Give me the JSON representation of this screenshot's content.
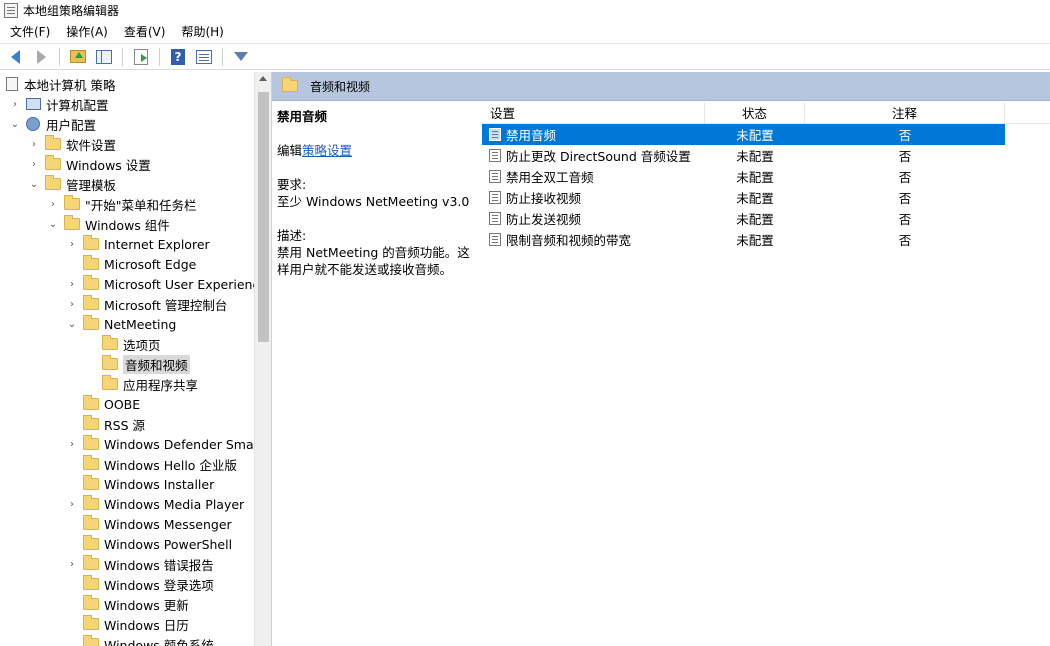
{
  "window": {
    "title": "本地组策略编辑器"
  },
  "menu": [
    "文件(F)",
    "操作(A)",
    "查看(V)",
    "帮助(H)"
  ],
  "toolbar": {
    "icons": [
      "back-icon",
      "forward-icon",
      "up-folder-icon",
      "show-hide-tree-icon",
      "export-list-icon",
      "help-icon",
      "properties-icon",
      "filter-icon"
    ]
  },
  "tree": {
    "root": "本地计算机 策略",
    "items": [
      {
        "label": "计算机配置",
        "chevron": "›",
        "icon": "pc"
      },
      {
        "label": "用户配置",
        "chevron": "⌄",
        "icon": "user"
      },
      {
        "label": "软件设置",
        "chevron": "›",
        "icon": "folder"
      },
      {
        "label": "Windows 设置",
        "chevron": "›",
        "icon": "folder"
      },
      {
        "label": "管理模板",
        "chevron": "⌄",
        "icon": "folder"
      },
      {
        "label": "\"开始\"菜单和任务栏",
        "chevron": "›",
        "icon": "folder"
      },
      {
        "label": "Windows 组件",
        "chevron": "⌄",
        "icon": "folder"
      },
      {
        "label": "Internet Explorer",
        "chevron": "›",
        "icon": "folder"
      },
      {
        "label": "Microsoft Edge",
        "chevron": "",
        "icon": "folder"
      },
      {
        "label": "Microsoft User Experience",
        "chevron": "›",
        "icon": "folder"
      },
      {
        "label": "Microsoft 管理控制台",
        "chevron": "›",
        "icon": "folder"
      },
      {
        "label": "NetMeeting",
        "chevron": "⌄",
        "icon": "folder"
      },
      {
        "label": "选项页",
        "chevron": "",
        "icon": "folder"
      },
      {
        "label": "音频和视频",
        "chevron": "",
        "icon": "folder"
      },
      {
        "label": "应用程序共享",
        "chevron": "",
        "icon": "folder"
      },
      {
        "label": "OOBE",
        "chevron": "",
        "icon": "folder"
      },
      {
        "label": "RSS 源",
        "chevron": "",
        "icon": "folder"
      },
      {
        "label": "Windows Defender SmartS",
        "chevron": "›",
        "icon": "folder"
      },
      {
        "label": "Windows Hello 企业版",
        "chevron": "",
        "icon": "folder"
      },
      {
        "label": "Windows Installer",
        "chevron": "",
        "icon": "folder"
      },
      {
        "label": "Windows Media Player",
        "chevron": "›",
        "icon": "folder"
      },
      {
        "label": "Windows Messenger",
        "chevron": "",
        "icon": "folder"
      },
      {
        "label": "Windows PowerShell",
        "chevron": "",
        "icon": "folder"
      },
      {
        "label": "Windows 错误报告",
        "chevron": "›",
        "icon": "folder"
      },
      {
        "label": "Windows 登录选项",
        "chevron": "",
        "icon": "folder"
      },
      {
        "label": "Windows 更新",
        "chevron": "",
        "icon": "folder"
      },
      {
        "label": "Windows 日历",
        "chevron": "",
        "icon": "folder"
      },
      {
        "label": "Windows 颜色系统",
        "chevron": "",
        "icon": "folder"
      }
    ]
  },
  "right": {
    "header_title": "音频和视频",
    "description": {
      "title": "禁用音频",
      "edit_prefix": "编辑",
      "edit_link": "策略设置",
      "requirement_label": "要求:",
      "requirement_value": "至少 Windows NetMeeting v3.0",
      "desc_label": "描述:",
      "desc_value": "禁用 NetMeeting 的音频功能。这样用户就不能发送或接收音频。"
    },
    "columns": [
      "设置",
      "状态",
      "注释"
    ],
    "rows": [
      {
        "name": "禁用音频",
        "state": "未配置",
        "comment": "否"
      },
      {
        "name": "防止更改 DirectSound 音频设置",
        "state": "未配置",
        "comment": "否"
      },
      {
        "name": "禁用全双工音频",
        "state": "未配置",
        "comment": "否"
      },
      {
        "name": "防止接收视频",
        "state": "未配置",
        "comment": "否"
      },
      {
        "name": "防止发送视频",
        "state": "未配置",
        "comment": "否"
      },
      {
        "name": "限制音频和视频的带宽",
        "state": "未配置",
        "comment": "否"
      }
    ]
  },
  "colors": {
    "selection": "#0078d7",
    "header_band": "#b6c6de",
    "link": "#1a5fb4"
  }
}
